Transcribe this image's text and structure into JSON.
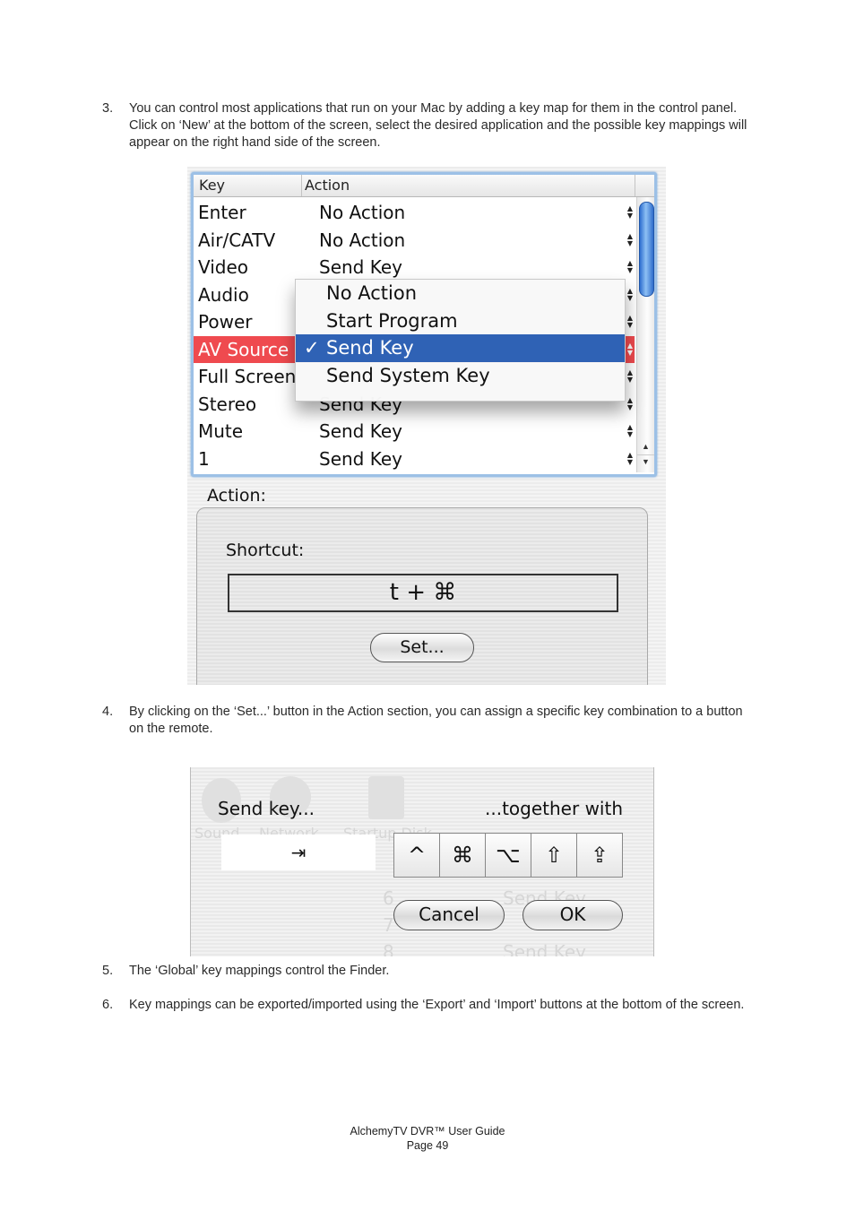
{
  "steps": [
    {
      "number": "3.",
      "text": "You can control most applications that run on your Mac by adding a key map for them in the control panel. Click on ‘New’ at the bottom of the screen, select the desired application and the possible key mappings will appear on the right hand side of the screen."
    },
    {
      "number": "4.",
      "text": "By clicking on the ‘Set...’ button in the Action section, you can assign a specific key combination to a button on the remote."
    },
    {
      "number": "5.",
      "text": "The ‘Global’ key mappings control the Finder."
    },
    {
      "number": "6.",
      "text": "Key mappings can be exported/imported using the ‘Export’ and ‘Import’ buttons at the bottom of the screen."
    }
  ],
  "keymap_panel": {
    "columns": {
      "key": "Key",
      "action": "Action"
    },
    "rows": [
      {
        "key": "Enter",
        "action": "No Action"
      },
      {
        "key": "Air/CATV",
        "action": "No Action"
      },
      {
        "key": "Video",
        "action": "Send Key"
      },
      {
        "key": "Audio",
        "action": ""
      },
      {
        "key": "Power",
        "action": ""
      },
      {
        "key": "AV Source",
        "action": "",
        "selected": true
      },
      {
        "key": "Full Screen",
        "action": ""
      },
      {
        "key": "Stereo",
        "action": "Send Key"
      },
      {
        "key": "Mute",
        "action": "Send Key"
      },
      {
        "key": "1",
        "action": "Send Key"
      }
    ],
    "stepper_glyph": "▲▼",
    "popup_menu": {
      "items": [
        "No Action",
        "Start Program",
        "Send Key",
        "Send System Key"
      ],
      "selected": "Send Key",
      "check_glyph": "✓"
    },
    "action_section": {
      "title": "Action:",
      "shortcut_label": "Shortcut:",
      "shortcut_value": "t + ⌘",
      "set_button": "Set..."
    },
    "colors": {
      "selected_row": "#ef4a4f",
      "menu_highlight": "#2f62b5",
      "focus_ring": "#9cc0e6"
    }
  },
  "send_key_dialog": {
    "send_key_label": "Send key...",
    "together_label": "...together with",
    "key_value": "⇥",
    "modifiers": [
      {
        "name": "control",
        "glyph": "^"
      },
      {
        "name": "command",
        "glyph": "⌘"
      },
      {
        "name": "option",
        "glyph": "⌥"
      },
      {
        "name": "shift",
        "glyph": "⇧"
      },
      {
        "name": "caps-lock",
        "glyph": "⇪"
      }
    ],
    "cancel_button": "Cancel",
    "ok_button": "OK",
    "background_ghost": {
      "labels": [
        "Sound",
        "Network",
        "Startup Disk"
      ],
      "rows": [
        "6",
        "7",
        "8"
      ],
      "row_action": "Send Key"
    }
  },
  "footer": {
    "title": "AlchemyTV DVR™ User Guide",
    "page": "Page 49"
  }
}
